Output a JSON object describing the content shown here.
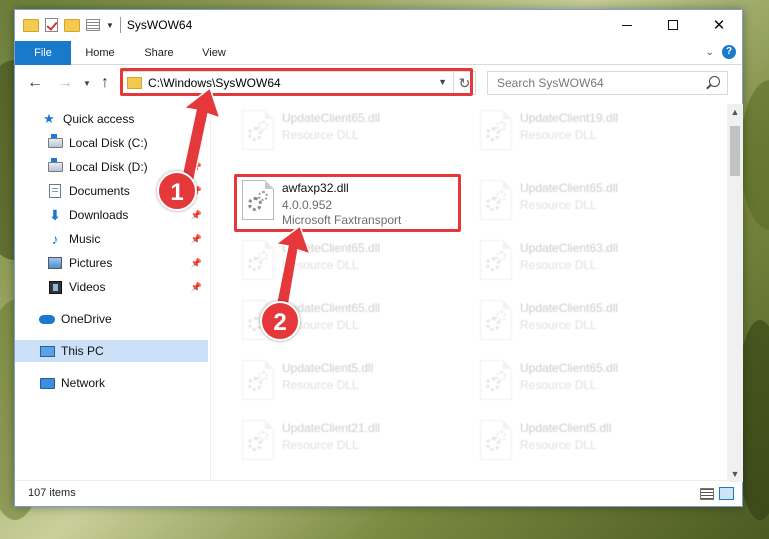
{
  "window": {
    "title": "SysWOW64"
  },
  "ribbon": {
    "tabs": [
      "File",
      "Home",
      "Share",
      "View"
    ]
  },
  "navbar": {
    "address": "C:\\Windows\\SysWOW64",
    "search_placeholder": "Search SysWOW64"
  },
  "sidebar": {
    "items": [
      {
        "label": "Quick access",
        "icon": "star-icon"
      },
      {
        "label": "Local Disk (C:)",
        "icon": "drive-icon",
        "pinned": true
      },
      {
        "label": "Local Disk (D:)",
        "icon": "drive-icon",
        "pinned": true
      },
      {
        "label": "Documents",
        "icon": "documents-icon",
        "pinned": true
      },
      {
        "label": "Downloads",
        "icon": "downloads-icon",
        "pinned": true
      },
      {
        "label": "Music",
        "icon": "music-icon",
        "pinned": true
      },
      {
        "label": "Pictures",
        "icon": "pictures-icon",
        "pinned": true
      },
      {
        "label": "Videos",
        "icon": "videos-icon",
        "pinned": true
      },
      {
        "label": "OneDrive",
        "icon": "onedrive-icon"
      },
      {
        "label": "This PC",
        "icon": "this-pc-icon",
        "selected": true
      },
      {
        "label": "Network",
        "icon": "network-icon"
      }
    ]
  },
  "files": {
    "highlighted": {
      "name": "awfaxp32.dll",
      "version": "4.0.0.952",
      "description": "Microsoft Faxtransport"
    },
    "left_column": [
      {
        "name": "UpdateClient65.dll",
        "type": "Resource DLL"
      },
      {
        "name": "UpdateClient65.dll",
        "type": "Resource DLL"
      },
      {
        "name": "UpdateClient65.dll",
        "type": "Resource DLL"
      },
      {
        "name": "UpdateClient5.dll",
        "type": "Resource DLL"
      },
      {
        "name": "UpdateClient21.dll",
        "type": "Resource DLL"
      }
    ],
    "right_column": [
      {
        "name": "UpdateClient19.dll",
        "type": "Resource DLL"
      },
      {
        "name": "UpdateClient65.dll",
        "type": "Resource DLL"
      },
      {
        "name": "UpdateClient63.dll",
        "type": "Resource DLL"
      },
      {
        "name": "UpdateClient65.dll",
        "type": "Resource DLL"
      },
      {
        "name": "UpdateClient65.dll",
        "type": "Resource DLL"
      },
      {
        "name": "UpdateClient5.dll",
        "type": "Resource DLL"
      }
    ]
  },
  "status": {
    "item_count": "107 items"
  },
  "callouts": {
    "step1": "1",
    "step2": "2",
    "color": "#e5383b"
  }
}
